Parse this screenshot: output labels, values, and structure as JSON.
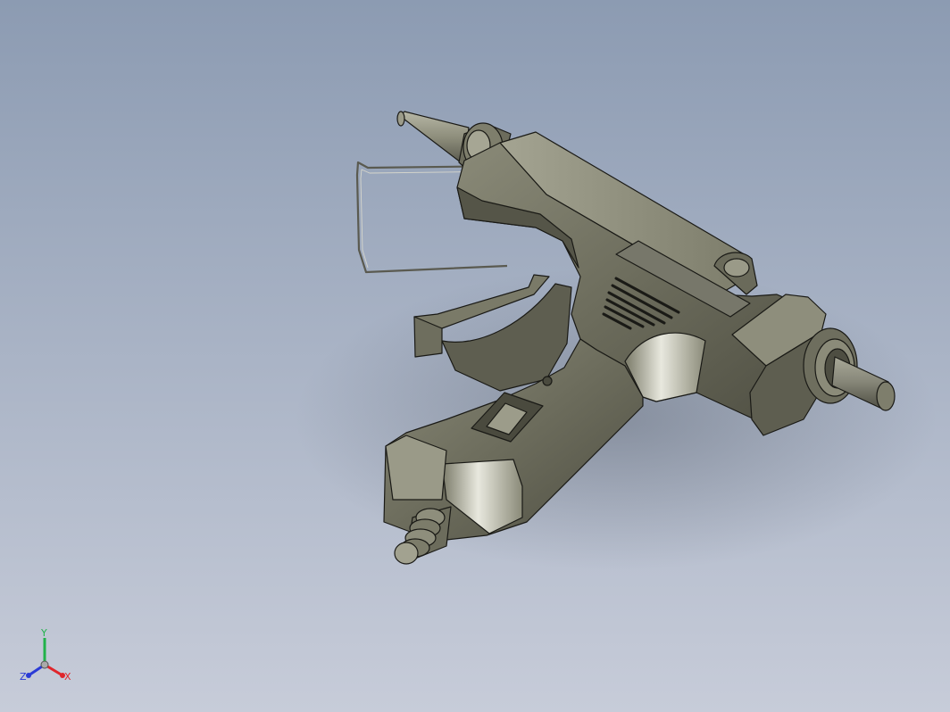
{
  "viewport": {
    "background_top": "#8c9bb2",
    "background_bottom": "#c7ccd9"
  },
  "model": {
    "body_color": "#6f6f60",
    "highlight_color": "#c9c9bd",
    "shadow_color": "#3c3c34",
    "edge_color": "#1a1a16"
  },
  "triad": {
    "x_label": "X",
    "y_label": "Y",
    "z_label": "Z",
    "x_color": "#e0252b",
    "y_color": "#21b24a",
    "z_color": "#2b3bd6"
  }
}
